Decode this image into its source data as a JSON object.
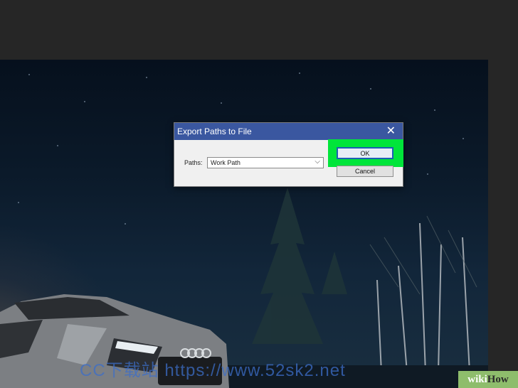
{
  "dialog": {
    "title": "Export Paths to File",
    "paths_label": "Paths:",
    "paths_value": "Work Path",
    "ok_label": "OK",
    "cancel_label": "Cancel"
  },
  "highlight_color": "#00e53a",
  "watermark": "CC下载站 https://www.52sk2.net",
  "branding": {
    "wiki": "wiki",
    "how": "How"
  }
}
